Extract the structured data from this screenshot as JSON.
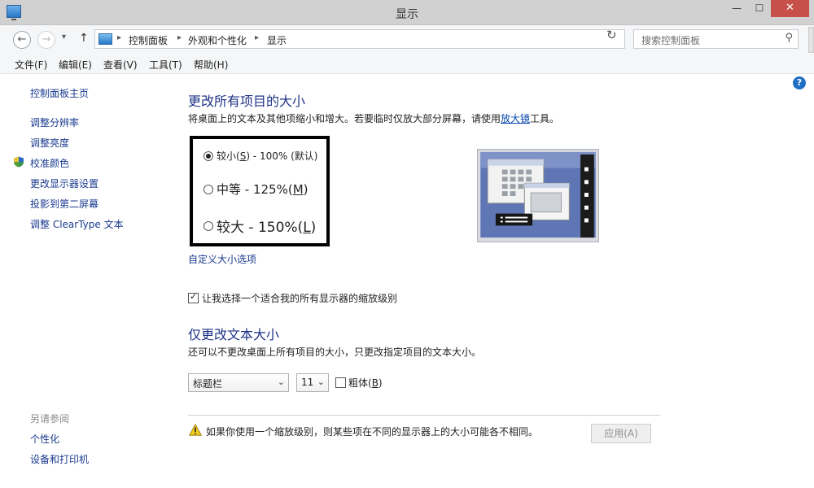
{
  "window": {
    "title": "显示"
  },
  "address_bar": {
    "crumbs": [
      "控制面板",
      "外观和个性化",
      "显示"
    ],
    "search_placeholder": "搜索控制面板"
  },
  "menu": {
    "items": [
      "文件(F)",
      "编辑(E)",
      "查看(V)",
      "工具(T)",
      "帮助(H)"
    ]
  },
  "sidebar": {
    "home": "控制面板主页",
    "links": [
      "调整分辨率",
      "调整亮度",
      "校准颜色",
      "更改显示器设置",
      "投影到第二屏幕",
      "调整 ClearType 文本"
    ],
    "see_also_title": "另请参阅",
    "see_also_links": [
      "个性化",
      "设备和打印机"
    ]
  },
  "main": {
    "heading1": "更改所有项目的大小",
    "desc1_before": "将桌面上的文本及其他项缩小和增大。若要临时仅放大部分屏幕，请使用",
    "desc1_link": "放大镜",
    "desc1_after": "工具。",
    "size_options": [
      {
        "text_pre": "较小(",
        "key": "S",
        "text_post": ") - 100% (默认)",
        "selected": true
      },
      {
        "text_pre": "中等 - 125%(",
        "key": "M",
        "text_post": ")",
        "selected": false
      },
      {
        "text_pre": "较大 - 150%(",
        "key": "L",
        "text_post": ")",
        "selected": false
      }
    ],
    "custom_link": "自定义大小选项",
    "scaling_checkbox_label": "让我选择一个适合我的所有显示器的缩放级别",
    "scaling_checkbox_checked": true,
    "heading2": "仅更改文本大小",
    "desc2": "还可以不更改桌面上所有项目的大小，只更改指定项目的文本大小。",
    "item_select": "标题栏",
    "font_size_select": "11",
    "bold_label_pre": "粗体(",
    "bold_key": "B",
    "bold_label_post": ")",
    "bold_checked": false,
    "warning": "如果你使用一个缩放级别，则某些项在不同的显示器上的大小可能各不相同。",
    "apply_button": "应用(A)"
  },
  "colors": {
    "heading": "#1e3287",
    "link": "#1a3a8f",
    "close_button": "#c7504a"
  }
}
